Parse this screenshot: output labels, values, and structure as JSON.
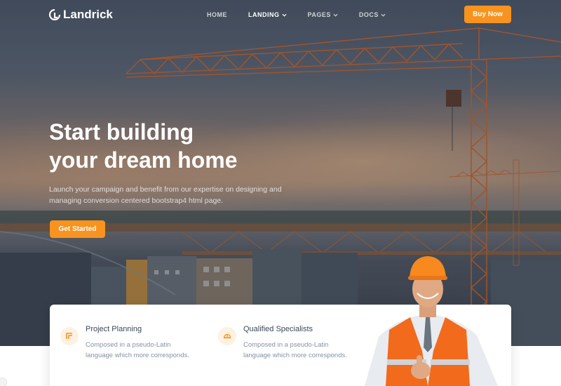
{
  "brand": {
    "name": "Landrick"
  },
  "nav": {
    "items": [
      {
        "label": "HOME",
        "dropdown": false,
        "active": false
      },
      {
        "label": "LANDING",
        "dropdown": true,
        "active": true
      },
      {
        "label": "PAGES",
        "dropdown": true,
        "active": false
      },
      {
        "label": "DOCS",
        "dropdown": true,
        "active": false
      }
    ],
    "cta_label": "Buy Now"
  },
  "hero": {
    "headline_line1": "Start building",
    "headline_line2": "your dream home",
    "subtext": "Launch your campaign and benefit from our expertise on designing and managing conversion centered bootstrap4 html page.",
    "cta_label": "Get Started"
  },
  "features": [
    {
      "icon": "blueprint-icon",
      "title": "Project Planning",
      "description": "Composed in a pseudo-Latin language which more corresponds."
    },
    {
      "icon": "helmet-icon",
      "title": "Qualified Specialists",
      "description": "Composed in a pseudo-Latin language which more corresponds."
    }
  ],
  "colors": {
    "accent": "#f7931e",
    "heading": "#3c4858",
    "muted": "#8492a6"
  }
}
